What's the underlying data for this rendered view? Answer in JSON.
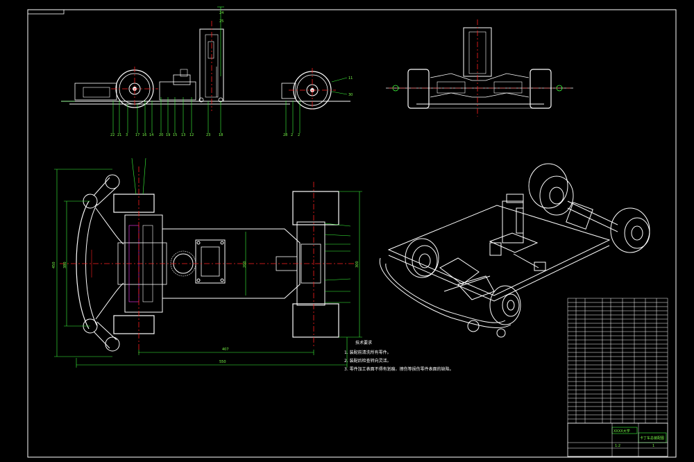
{
  "drawing": {
    "colors": {
      "background": "#000000",
      "outline": "#ffffff",
      "annotation": "#3cff3c",
      "centerline": "#ff2020",
      "hidden": "#ff3cff"
    }
  },
  "dimensions": {
    "overall_height": "450",
    "inner_height": "380",
    "center_height": "200",
    "wheel_track": "300",
    "wheelbase": "407",
    "overall_length": "550"
  },
  "notes": {
    "title": "技术要求",
    "items": [
      "1. 装配前清洗所有零件。",
      "2. 装配后检查转向灵活。",
      "3. 零件加工表面不得有划痕、擦伤等损伤零件表面的缺陷。"
    ]
  },
  "title_block": {
    "company": "XXXX大学",
    "drawing_name": "卡丁车总装配图",
    "scale": "1:2",
    "sheet": "1"
  }
}
